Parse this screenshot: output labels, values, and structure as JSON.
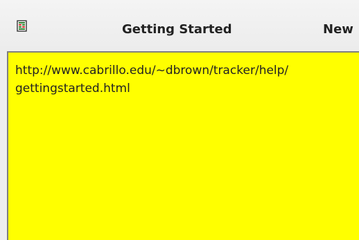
{
  "header": {
    "icon": "document-icon",
    "title": "Getting Started",
    "new_label": "New"
  },
  "note": {
    "lines": [
      "http://www.cabrillo.edu/~dbrown/tracker/help/",
      "gettingstarted.html"
    ],
    "background": "#ffff00"
  }
}
